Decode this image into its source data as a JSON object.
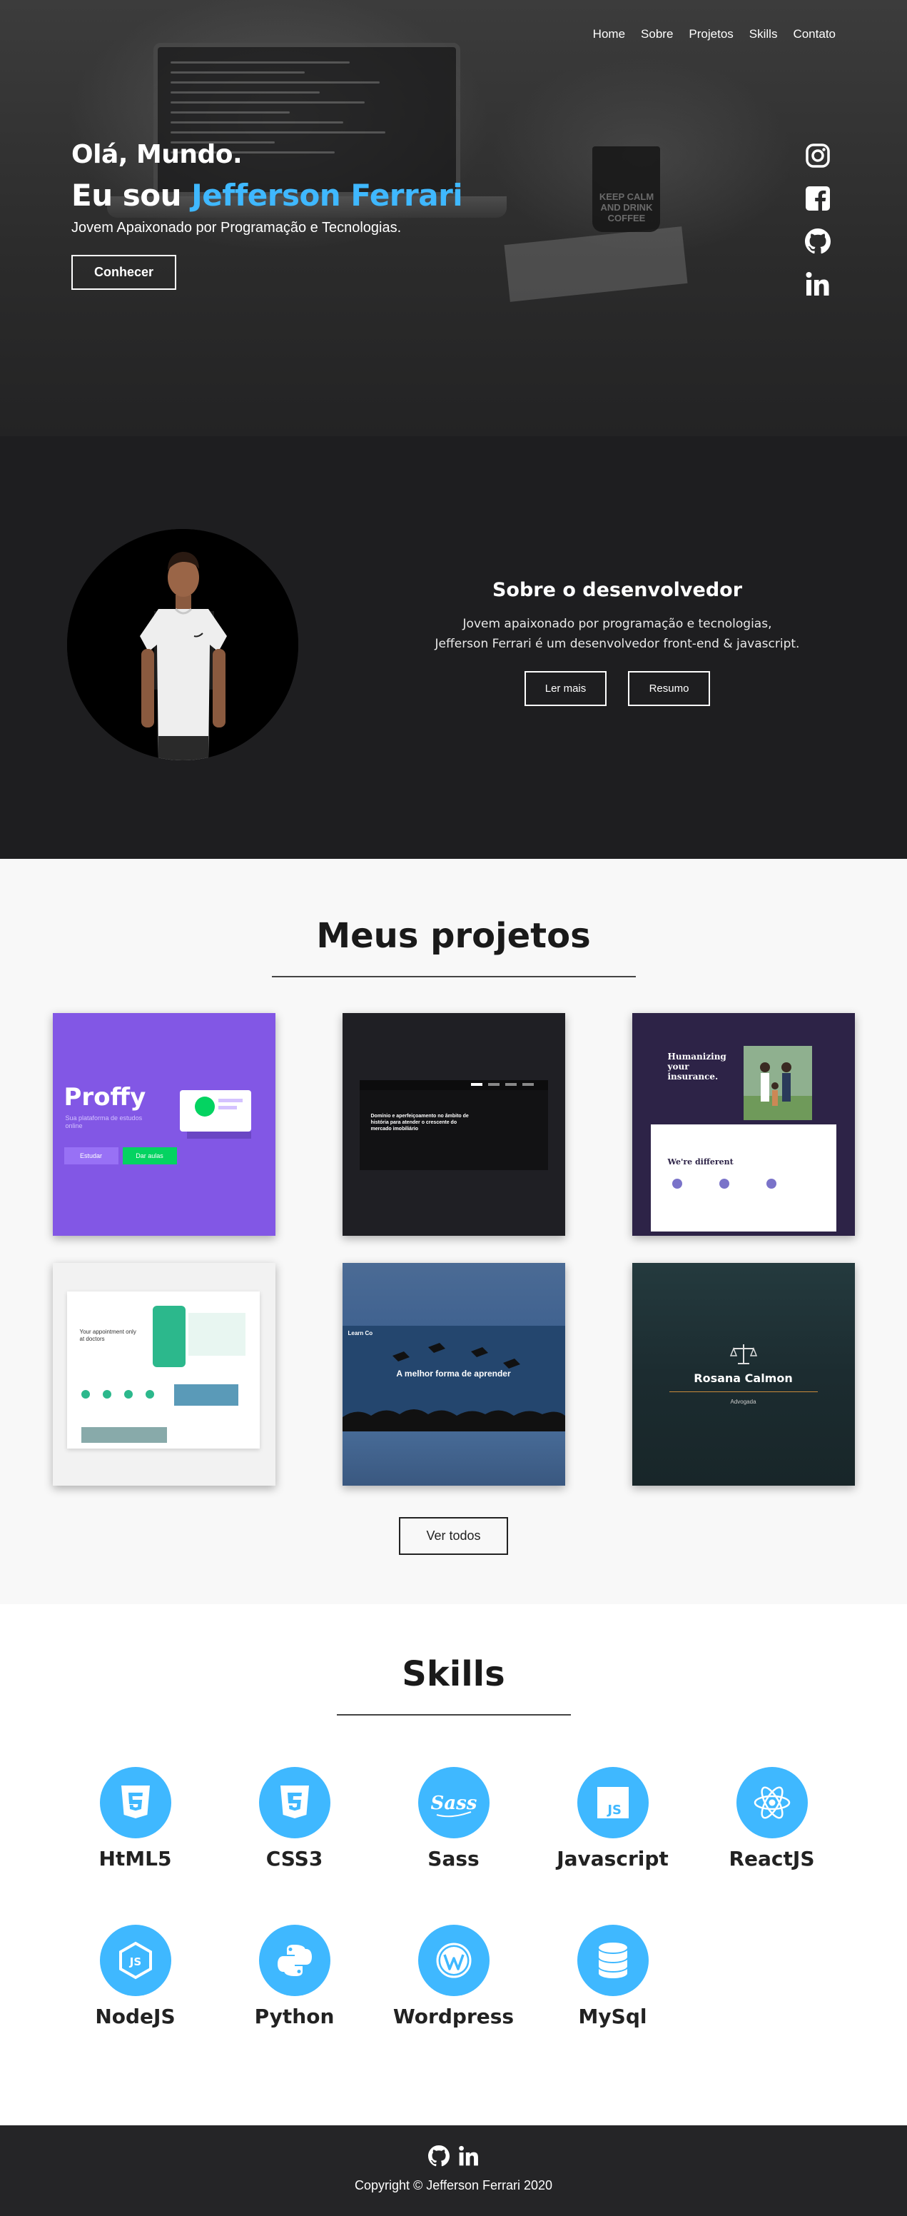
{
  "nav": {
    "items": [
      "Home",
      "Sobre",
      "Projetos",
      "Skills",
      "Contato"
    ]
  },
  "hero": {
    "greeting": "Olá, Mundo.",
    "intro": "Eu sou",
    "name": "Jefferson Ferrari",
    "subtitle": "Jovem Apaixonado por Programação e Tecnologias.",
    "button": "Conhecer",
    "mug_text": "KEEP CALM AND DRINK COFFEE",
    "accent_color": "#3fb8ff",
    "socials": [
      "instagram-icon",
      "facebook-icon",
      "github-icon",
      "linkedin-icon"
    ]
  },
  "about": {
    "title": "Sobre o desenvolvedor",
    "desc_line1": "Jovem apaixonado por programação e tecnologias,",
    "desc_line2": "Jefferson Ferrari é um desenvolvedor front-end & javascript.",
    "btn_more": "Ler mais",
    "btn_resume": "Resumo"
  },
  "projects": {
    "title": "Meus projetos",
    "view_all": "Ver todos",
    "items": [
      {
        "logo": "Proffy",
        "text": "Sua plataforma de estudos online",
        "btn1": "Estudar",
        "btn2": "Dar aulas"
      },
      {
        "text": "Domínio e aperfeiçoamento no âmbito de história para atender o crescente do mercado imobiliário"
      },
      {
        "headline": "Humanizing your insurance.",
        "sub": "We're different"
      },
      {
        "headline": "Your appointment only at doctors"
      },
      {
        "logo": "Learn Co",
        "headline": "A melhor forma de aprender"
      },
      {
        "name": "Rosana Calmon",
        "role": "Advogada"
      }
    ]
  },
  "skills": {
    "title": "Skills",
    "items": [
      "HtML5",
      "CSS3",
      "Sass",
      "Javascript",
      "ReactJS",
      "NodeJS",
      "Python",
      "Wordpress",
      "MySql"
    ]
  },
  "footer": {
    "copyright": "Copyright © Jefferson Ferrari 2020"
  }
}
